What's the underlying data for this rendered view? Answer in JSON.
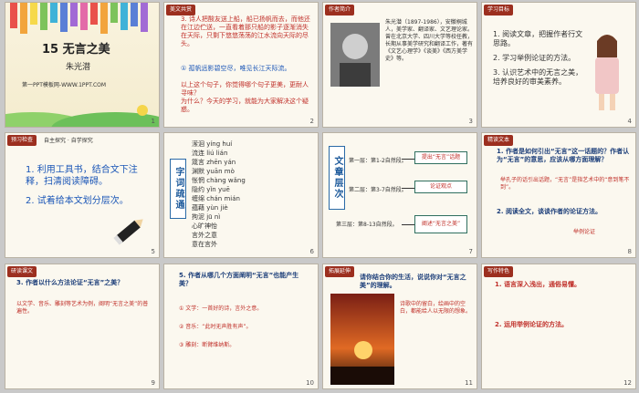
{
  "slides": [
    {
      "n": "1",
      "title": "15 无言之美",
      "author": "朱光潜",
      "footer": "第一PPT模板网-WWW.1PPT.COM"
    },
    {
      "n": "2",
      "tag": "美文共赏",
      "lines": [
        "3. 诗人把酸友送上船，船已扬帆而去，而他还在江边伫送，一直看着那只船的影子逐渐消失在天际，只剩下悠悠荡荡的江水流向天际的尽头。",
        "① 孤帆远影碧空尽，唯见长江天际流。",
        "以上这个句子，你觉得哪个句子更美，更耐人寻味？",
        "为什么？今天的学习，就能为大家解决这个疑惑。"
      ]
    },
    {
      "n": "3",
      "tag": "作者简介",
      "bio": "朱光潜（1897-1986），安徽桐城人，美学家、翻译家、文艺理论家。曾在北京大学、四川大学等校任教，长期从事美学研究和翻译工作，著有《文艺心理学》《谈美》《西方美学史》等。"
    },
    {
      "n": "4",
      "tag": "学习目标",
      "goals": [
        "1. 阅读文章，把握作者行文思路。",
        "2. 学习举例论证的方法。",
        "3. 认识艺术中的无言之美，培养良好的审美素养。"
      ]
    },
    {
      "n": "5",
      "tag": "预习检查",
      "tag2": "自主探究 · 自学探究",
      "items": [
        "1. 利用工具书，结合文下注释，扫清阅读障碍。",
        "2. 试着给本文划分层次。"
      ]
    },
    {
      "n": "6",
      "side": "字词疏通",
      "words": [
        "潆洄 yíng huí",
        "流连 liú lián",
        "箴言 zhēn yán",
        "渊默 yuān mò",
        "怅惘 chàng wǎng",
        "隐约 yǐn yuē",
        "缠绵 chán mián",
        "蕴藉 yùn jiè",
        "拘泥 jū nì",
        "心旷神怡",
        "言外之意",
        "意在言外"
      ]
    },
    {
      "n": "7",
      "side": "文章层次",
      "layers": [
        "第一层：第1-2自然段。",
        "第二层：第3-7自然段。",
        "第三层：第8-13自然段。"
      ],
      "boxes": [
        "提出“无言”话题",
        "论证观点",
        "阐述“无言之美”"
      ]
    },
    {
      "n": "8",
      "tag": "精读文本",
      "q1": "1. 作者是如何引出“无言”这一话题的？作者认为“无言”的意思，应该从哪方面理解？",
      "a1": "举孔子的话引出话题，“无言”是指艺术中的“意到笔不到”。",
      "q2": "2. 阅读全文，谈谈作者的论证方法。",
      "a2": "举例论证"
    },
    {
      "n": "9",
      "tag": "研读课文",
      "q": "3. 作者以什么方法论证“无言”之美？",
      "a": "以文学、音乐、雕刻等艺术为例，阐明“无言之美”的普遍性。"
    },
    {
      "n": "10",
      "q": "5. 作者从哪几个方面阐明“无言”也能产生美？",
      "a": [
        "① 文学：一首好的诗，言外之意。",
        "② 音乐：“此时无声胜有声”。",
        "③ 雕刻：断臂维纳斯。"
      ]
    },
    {
      "n": "11",
      "tag": "拓展延伸",
      "q": "请你结合你的生活，说说你对“无言之美”的理解。",
      "a": "诗歌中的留白，绘画中的空白，都能给人以无限的想象。"
    },
    {
      "n": "12",
      "tag": "写作特色",
      "points": [
        "1. 语言深入浅出，通俗易懂。",
        "2. 运用举例论证的方法。"
      ]
    }
  ]
}
